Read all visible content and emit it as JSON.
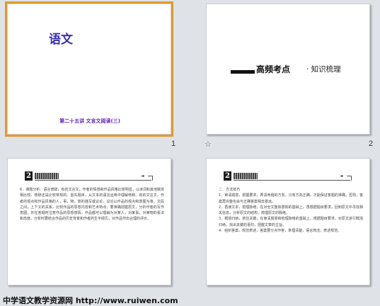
{
  "slides": [
    {
      "number": "1",
      "title": "语文",
      "subtitle": "第二十五讲  文言文阅读(三)"
    },
    {
      "number": "2",
      "star": "☆",
      "hero_title": "高频考点",
      "hero_rest": "· 知识梳理"
    },
    {
      "badge": "2",
      "body": "6．课题分析：语言修辞，有的文言文，作者的情感和作品风格比较明显，以诗词和其他赋体相比较。修辞还是比较常规的。首先题目，从文本的语言运用中理解修辞。有的文言文，作者的观点和作品风格的人，事，物，景的描写或议论，议论以作品的观点和意图为准。文段之间，上下文的关系，比较作品的思想内容和艺术特点，要准确把握原文，分析作者的写作意图，并在答题时注意作品的思想感情。作品都可以理解为对某人，对某事，对某物的看法和态度。分析时要结合作品的历史背景和作者的生平经历，对作品作出合理的评价。"
    },
    {
      "badge": "2",
      "heading": "二．方法技巧",
      "p1": "1．审清题意，把握要求，弄清命题的方向，只有方向正确，才能保证答题的准确，否则，答案再完整也会与正确答案相去甚远。",
      "p2": "2．再读文本，梳理脉络，在对全文整体感知的基础上，再根据题目要求，回到原文中寻找相关信息，分析原文的结构，梳理原文的脉络。",
      "p3": "3．概括归纳，抓住关键，在审清题意和梳理脉络的基础上，根据题目要求，对原文进行概括归纳，找出关键的语句，把握文章的主旨。",
      "p4": "4．组织答案，规范表述，答案要分点作答，条理清楚，语言简洁，表述规范。"
    }
  ],
  "footer": "中学语文教学资源网 http://www.ruiwen.com"
}
